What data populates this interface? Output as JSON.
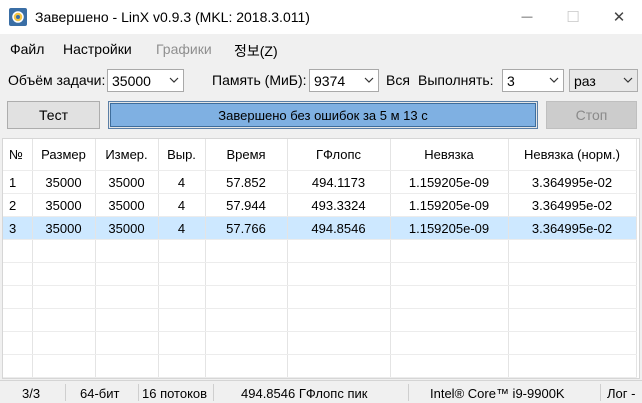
{
  "window": {
    "title": "Завершено - LinX v0.9.3 (MKL: 2018.3.011)",
    "icons": {
      "app": "gear-icon",
      "minimize": "minimize-icon",
      "maximize": "maximize-icon",
      "close": "close-icon"
    },
    "minimize_glyph": "—",
    "maximize_glyph": "☐",
    "close_glyph": "✕"
  },
  "menu": {
    "items": [
      {
        "label": "Файл",
        "enabled": true
      },
      {
        "label": "Настройки",
        "enabled": true
      },
      {
        "label": "Графики",
        "enabled": false
      },
      {
        "label": "정보(Z)",
        "enabled": true
      }
    ]
  },
  "params": {
    "problem_size_label": "Объём задачи:",
    "problem_size_value": "35000",
    "memory_label": "Память (МиБ):",
    "memory_value": "9374",
    "all_label": "Вся",
    "run_label": "Выполнять:",
    "run_value": "3",
    "run_unit": "раз"
  },
  "buttons": {
    "test": "Тест",
    "stop": "Стоп",
    "stop_enabled": false
  },
  "progress": {
    "text": "Завершено без ошибок за 5 м 13 с",
    "fraction": 1.0
  },
  "table": {
    "columns": [
      "№",
      "Размер",
      "Измер.",
      "Выр.",
      "Время",
      "ГФлопс",
      "Невязка",
      "Невязка (норм.)"
    ],
    "rows": [
      [
        "1",
        "35000",
        "35000",
        "4",
        "57.852",
        "494.1173",
        "1.159205e-09",
        "3.364995e-02"
      ],
      [
        "2",
        "35000",
        "35000",
        "4",
        "57.944",
        "493.3324",
        "1.159205e-09",
        "3.364995e-02"
      ],
      [
        "3",
        "35000",
        "35000",
        "4",
        "57.766",
        "494.8546",
        "1.159205e-09",
        "3.364995e-02"
      ]
    ],
    "selected_row": 2
  },
  "status": {
    "progress": "3/3",
    "bits": "64-бит",
    "threads": "16 потоков",
    "peak": "494.8546 ГФлопс пик",
    "cpu": "Intel® Core™ i9-9900K",
    "log": "Лог -"
  },
  "colors": {
    "progress_fill": "#7fb0e2",
    "selected_row": "#cde8ff"
  }
}
